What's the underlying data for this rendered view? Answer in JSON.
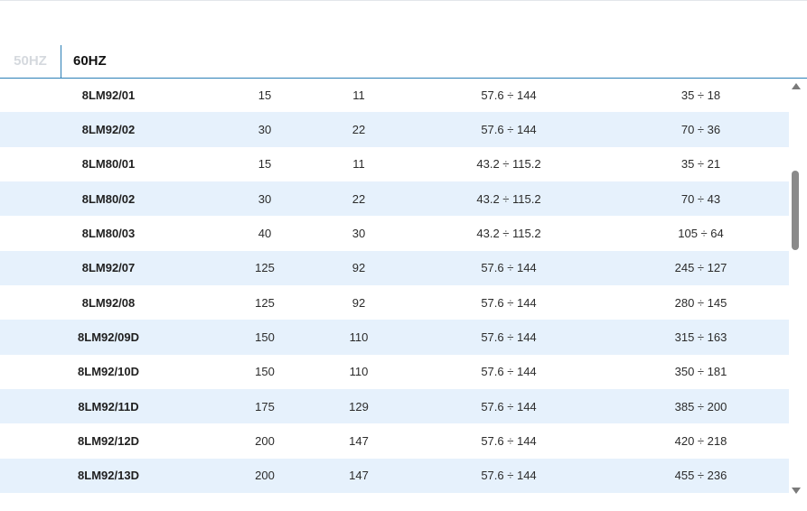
{
  "tabs": [
    {
      "label": "50HZ",
      "active": false
    },
    {
      "label": "60HZ",
      "active": true
    }
  ],
  "table": {
    "rows": [
      [
        "8LM92/01",
        "15",
        "11",
        "57.6 ÷ 144",
        "35 ÷ 18"
      ],
      [
        "8LM92/02",
        "30",
        "22",
        "57.6 ÷ 144",
        "70 ÷ 36"
      ],
      [
        "8LM80/01",
        "15",
        "11",
        "43.2 ÷ 115.2",
        "35 ÷ 21"
      ],
      [
        "8LM80/02",
        "30",
        "22",
        "43.2 ÷ 115.2",
        "70 ÷ 43"
      ],
      [
        "8LM80/03",
        "40",
        "30",
        "43.2 ÷ 115.2",
        "105 ÷ 64"
      ],
      [
        "8LM92/07",
        "125",
        "92",
        "57.6 ÷ 144",
        "245 ÷ 127"
      ],
      [
        "8LM92/08",
        "125",
        "92",
        "57.6 ÷ 144",
        "280 ÷ 145"
      ],
      [
        "8LM92/09D",
        "150",
        "110",
        "57.6 ÷ 144",
        "315 ÷ 163"
      ],
      [
        "8LM92/10D",
        "150",
        "110",
        "57.6 ÷ 144",
        "350 ÷ 181"
      ],
      [
        "8LM92/11D",
        "175",
        "129",
        "57.6 ÷ 144",
        "385 ÷ 200"
      ],
      [
        "8LM92/12D",
        "200",
        "147",
        "57.6 ÷ 144",
        "420 ÷ 218"
      ],
      [
        "8LM92/13D",
        "200",
        "147",
        "57.6 ÷ 144",
        "455 ÷ 236"
      ]
    ]
  },
  "colors": {
    "accent": "#2b7fb6",
    "row_stripe": "#e6f1fc",
    "inactive_tab": "#d5d9de"
  },
  "scrollbar": {
    "up_icon": "triangle-up",
    "down_icon": "triangle-down"
  }
}
